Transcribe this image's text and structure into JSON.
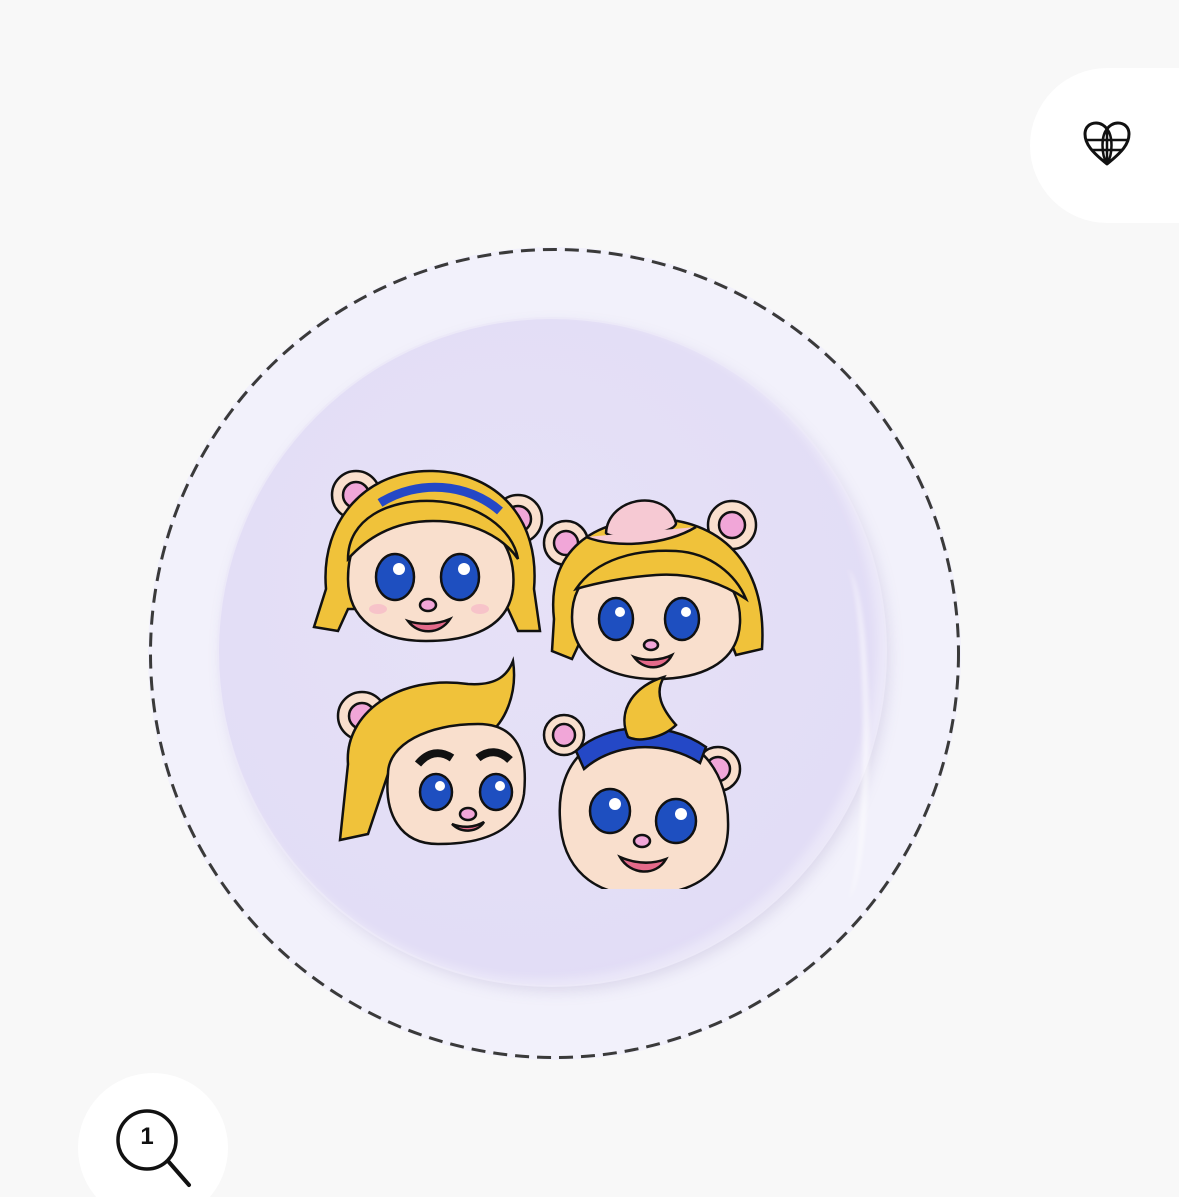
{
  "header": {
    "language_icon": "globe-heart-icon"
  },
  "product": {
    "image_label": "bear-girl-faces-badge"
  },
  "zoom": {
    "icon": "magnifier-icon",
    "count": "1"
  },
  "colors": {
    "page_background": "#f8f8f8",
    "outer_circle": "#f2f1fb",
    "badge": "#e2ddf6",
    "hair": "#f0c23a",
    "skin": "#f9dfcd",
    "ear_inner": "#f1a6d8",
    "eye_blue": "#1e4fc0",
    "headband_blue": "#2448c6",
    "hat_pink": "#f6c9d3"
  }
}
